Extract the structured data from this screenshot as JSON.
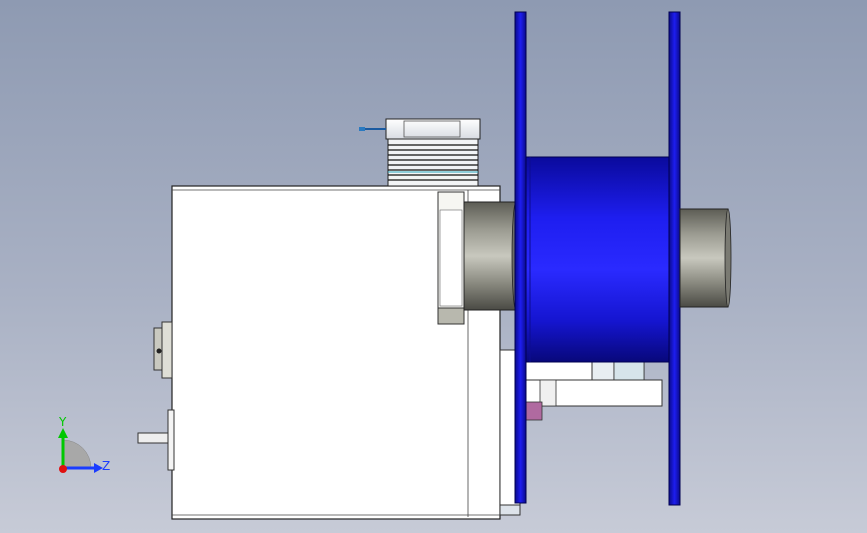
{
  "viewport": {
    "background_top": "#8e9ab2",
    "background_bottom": "#c7cbd7"
  },
  "model": {
    "reel_color": "#1414e0",
    "reel_flange_color": "#0f0fb5",
    "drum_color": "#1e1ef0",
    "hub_color": "#8a8a80",
    "housing_color": "#ffffff",
    "accent_color": "#b06aa0"
  },
  "triad": {
    "y_label": "Y",
    "z_label": "Z",
    "y_color": "#00c800",
    "z_color": "#1a3cff",
    "origin_color": "#e01010"
  }
}
